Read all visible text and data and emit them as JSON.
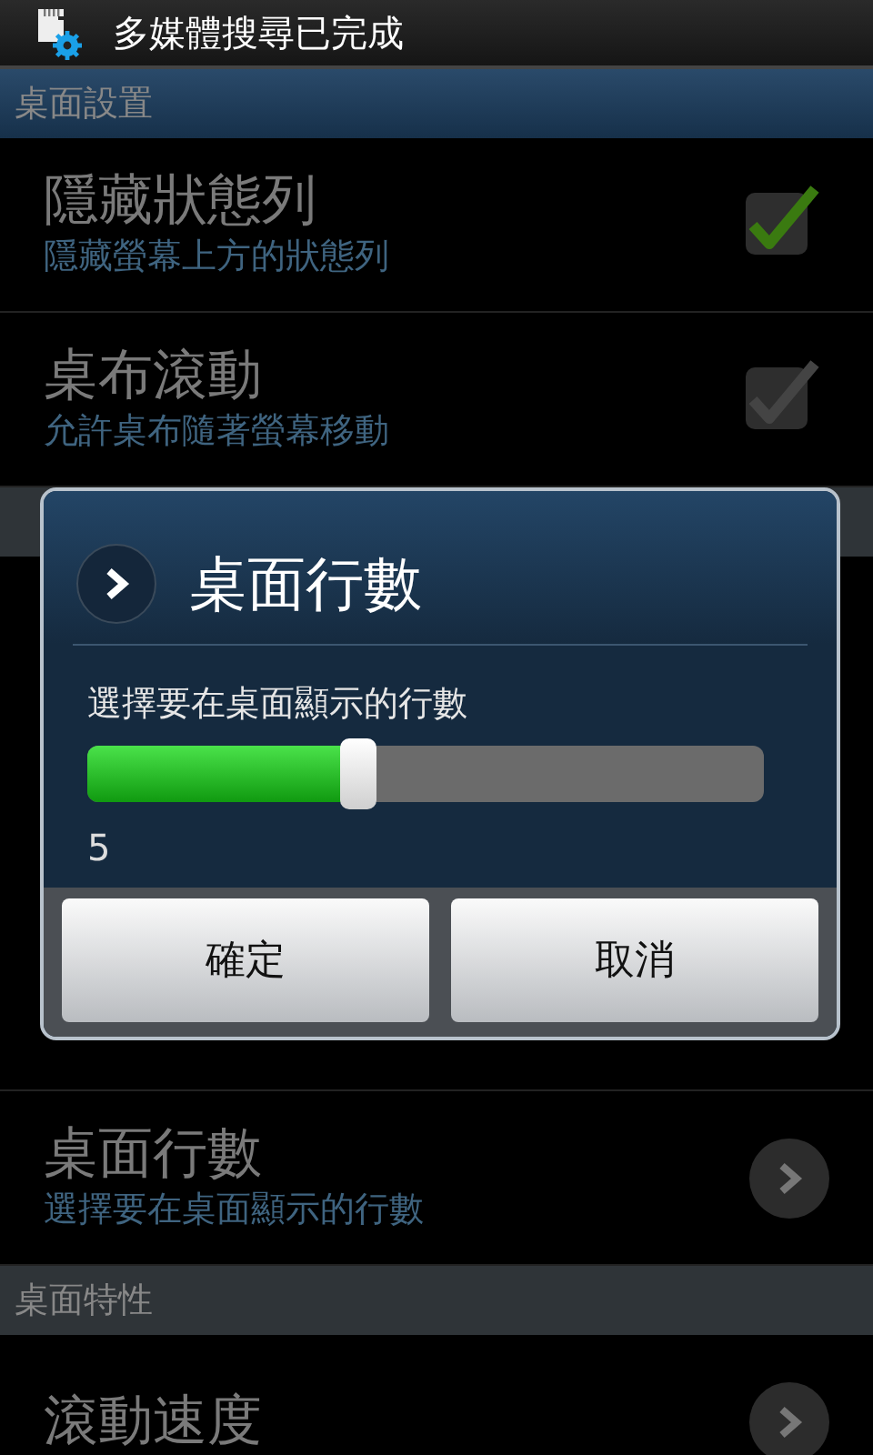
{
  "status_bar": {
    "notification": "多媒體搜尋已完成"
  },
  "settings": [
    {
      "kind": "header",
      "title": "桌面設置",
      "highlighted": true
    },
    {
      "kind": "checkbox",
      "title": "隱藏狀態列",
      "summary": "隱藏螢幕上方的狀態列",
      "checked": true
    },
    {
      "kind": "checkbox",
      "title": "桌布滾動",
      "summary": "允許桌布隨著螢幕移動",
      "checked": false
    },
    {
      "kind": "header",
      "highlighted": false
    },
    {
      "kind": "covered"
    },
    {
      "kind": "link",
      "title": "桌面行數",
      "summary": "選擇要在桌面顯示的行數"
    },
    {
      "kind": "header",
      "title": "桌面特性",
      "highlighted": false
    },
    {
      "kind": "link",
      "title": "滾動速度"
    }
  ],
  "dialog": {
    "title": "桌面行數",
    "message": "選擇要在桌面顯示的行數",
    "level": 0.4,
    "reading": "5",
    "buttons": [
      "確定",
      "取消"
    ]
  }
}
